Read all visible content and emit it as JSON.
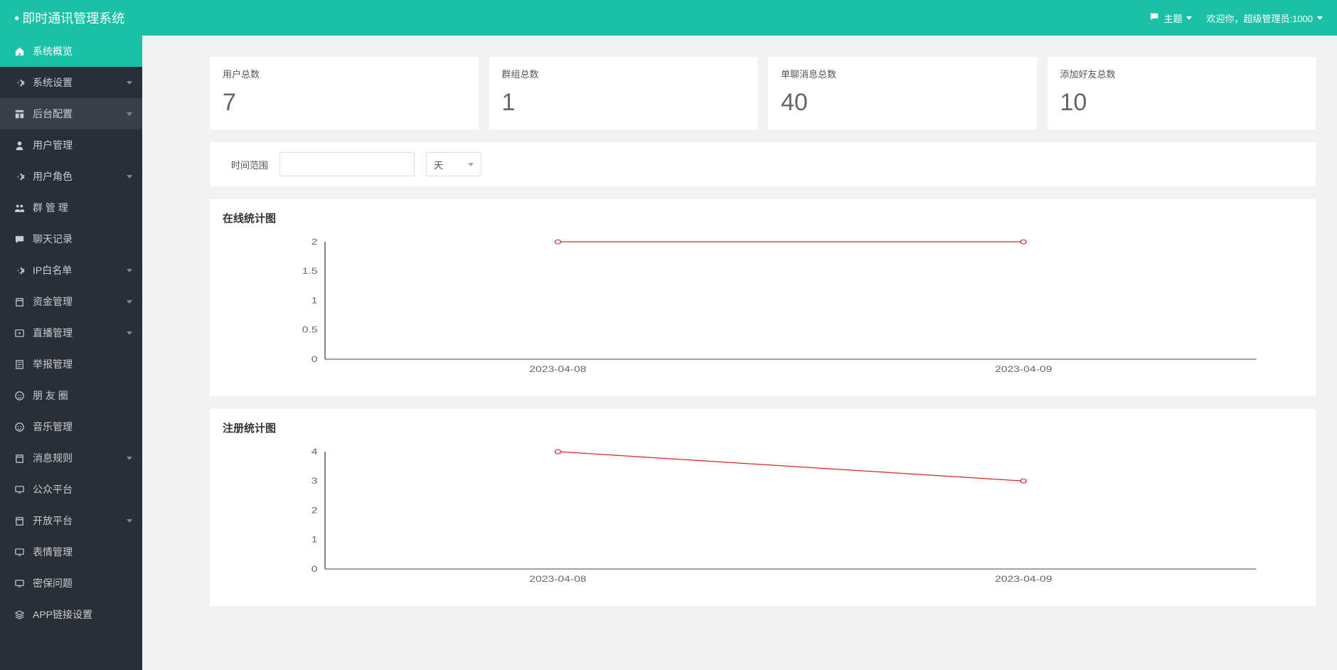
{
  "header": {
    "title": "即时通讯管理系统",
    "theme": "主题",
    "welcome": "欢迎你，超级管理员:1000"
  },
  "sidebar": [
    {
      "icon": "home",
      "label": "系统概览",
      "active": true,
      "expandable": false
    },
    {
      "icon": "gear",
      "label": "系统设置",
      "expandable": true
    },
    {
      "icon": "layout",
      "label": "后台配置",
      "expandable": true,
      "darker": true
    },
    {
      "icon": "user",
      "label": "用户管理",
      "expandable": false
    },
    {
      "icon": "gear",
      "label": "用户角色",
      "expandable": true
    },
    {
      "icon": "group",
      "label": "群 管 理",
      "expandable": false
    },
    {
      "icon": "chat",
      "label": "聊天记录",
      "expandable": false
    },
    {
      "icon": "gear",
      "label": "IP白名单",
      "expandable": true
    },
    {
      "icon": "calendar",
      "label": "资金管理",
      "expandable": true
    },
    {
      "icon": "play",
      "label": "直播管理",
      "expandable": true
    },
    {
      "icon": "report",
      "label": "举报管理",
      "expandable": false
    },
    {
      "icon": "smile",
      "label": "朋 友 圈",
      "expandable": false
    },
    {
      "icon": "smile",
      "label": "音乐管理",
      "expandable": false
    },
    {
      "icon": "calendar",
      "label": "消息规则",
      "expandable": true
    },
    {
      "icon": "monitor",
      "label": "公众平台",
      "expandable": false
    },
    {
      "icon": "calendar",
      "label": "开放平台",
      "expandable": true
    },
    {
      "icon": "monitor",
      "label": "表情管理",
      "expandable": false
    },
    {
      "icon": "monitor",
      "label": "密保问题",
      "expandable": false
    },
    {
      "icon": "stack",
      "label": "APP链接设置",
      "expandable": false
    }
  ],
  "stats": [
    {
      "title": "用户总数",
      "value": "7"
    },
    {
      "title": "群组总数",
      "value": "1"
    },
    {
      "title": "单聊消息总数",
      "value": "40"
    },
    {
      "title": "添加好友总数",
      "value": "10"
    }
  ],
  "filter": {
    "range_label": "时间范围",
    "unit_selected": "天"
  },
  "chart1_title": "在线统计图",
  "chart2_title": "注册统计图",
  "chart_data": [
    {
      "type": "line",
      "title": "在线统计图",
      "categories": [
        "2023-04-08",
        "2023-04-09"
      ],
      "values": [
        2,
        2
      ],
      "ylim": [
        0,
        2
      ],
      "yticks": [
        0,
        0.5,
        1,
        1.5,
        2
      ]
    },
    {
      "type": "line",
      "title": "注册统计图",
      "categories": [
        "2023-04-08",
        "2023-04-09"
      ],
      "values": [
        4,
        3
      ],
      "ylim": [
        0,
        4
      ],
      "yticks": [
        0,
        1,
        2,
        3,
        4
      ]
    }
  ]
}
